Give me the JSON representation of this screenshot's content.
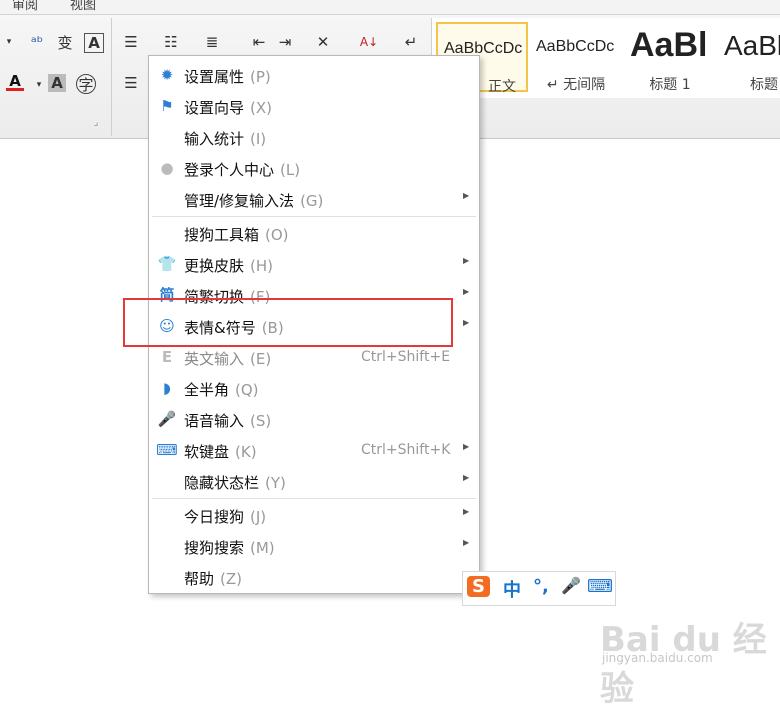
{
  "ribbon": {
    "tabs": [
      "审阅",
      "视图"
    ],
    "styles": [
      {
        "sample": "AaBbCcDc",
        "name": "正文"
      },
      {
        "sample": "AaBbCcDc",
        "name": "↵ 无间隔"
      },
      {
        "sample": "AaBl",
        "name": "标题 1"
      },
      {
        "sample": "AaBl",
        "name": "标题"
      }
    ],
    "colors": {
      "font_red": "#e02020",
      "selected_style_border": "#f3c44a"
    }
  },
  "menu": {
    "items": [
      {
        "label": "设置属性",
        "mnemonic": "(P)",
        "icon": "gear-icon",
        "shortcut": "",
        "submenu": false
      },
      {
        "label": "设置向导",
        "mnemonic": "(X)",
        "icon": "flag-icon",
        "shortcut": "",
        "submenu": false
      },
      {
        "label": "输入统计",
        "mnemonic": "(I)",
        "icon": "",
        "shortcut": "",
        "submenu": false
      },
      {
        "label": "登录个人中心",
        "mnemonic": "(L)",
        "icon": "user-icon",
        "shortcut": "",
        "submenu": false
      },
      {
        "label": "管理/修复输入法",
        "mnemonic": "(G)",
        "icon": "",
        "shortcut": "",
        "submenu": true
      },
      {
        "label": "搜狗工具箱",
        "mnemonic": "(O)",
        "icon": "",
        "shortcut": "",
        "submenu": false
      },
      {
        "label": "更换皮肤",
        "mnemonic": "(H)",
        "icon": "tshirt-icon",
        "shortcut": "",
        "submenu": true
      },
      {
        "label": "简繁切换",
        "mnemonic": "(F)",
        "icon": "simplified-traditional-icon",
        "shortcut": "",
        "submenu": true
      },
      {
        "label": "表情&符号",
        "mnemonic": "(B)",
        "icon": "smiley-icon",
        "shortcut": "",
        "submenu": true
      },
      {
        "label": "英文输入",
        "mnemonic": "(E)",
        "icon": "english-e-icon",
        "shortcut": "Ctrl+Shift+E",
        "submenu": false
      },
      {
        "label": "全半角",
        "mnemonic": "(Q)",
        "icon": "half-moon-icon",
        "shortcut": "",
        "submenu": false
      },
      {
        "label": "语音输入",
        "mnemonic": "(S)",
        "icon": "microphone-icon",
        "shortcut": "",
        "submenu": false
      },
      {
        "label": "软键盘",
        "mnemonic": "(K)",
        "icon": "keyboard-icon",
        "shortcut": "Ctrl+Shift+K",
        "submenu": true
      },
      {
        "label": "隐藏状态栏",
        "mnemonic": "(Y)",
        "icon": "",
        "shortcut": "",
        "submenu": true
      },
      {
        "label": "今日搜狗",
        "mnemonic": "(J)",
        "icon": "",
        "shortcut": "",
        "submenu": true
      },
      {
        "label": "搜狗搜索",
        "mnemonic": "(M)",
        "icon": "",
        "shortcut": "",
        "submenu": true
      },
      {
        "label": "帮助",
        "mnemonic": "(Z)",
        "icon": "",
        "shortcut": "",
        "submenu": true
      }
    ],
    "icon_color": "#2d7fd3"
  },
  "imebar": {
    "items": [
      "S",
      "中",
      "°,",
      "🎤",
      "⌨"
    ],
    "color": "#1a73c9"
  },
  "watermark": {
    "main": "Bai du 经验",
    "url": "jingyan.baidu.com"
  }
}
